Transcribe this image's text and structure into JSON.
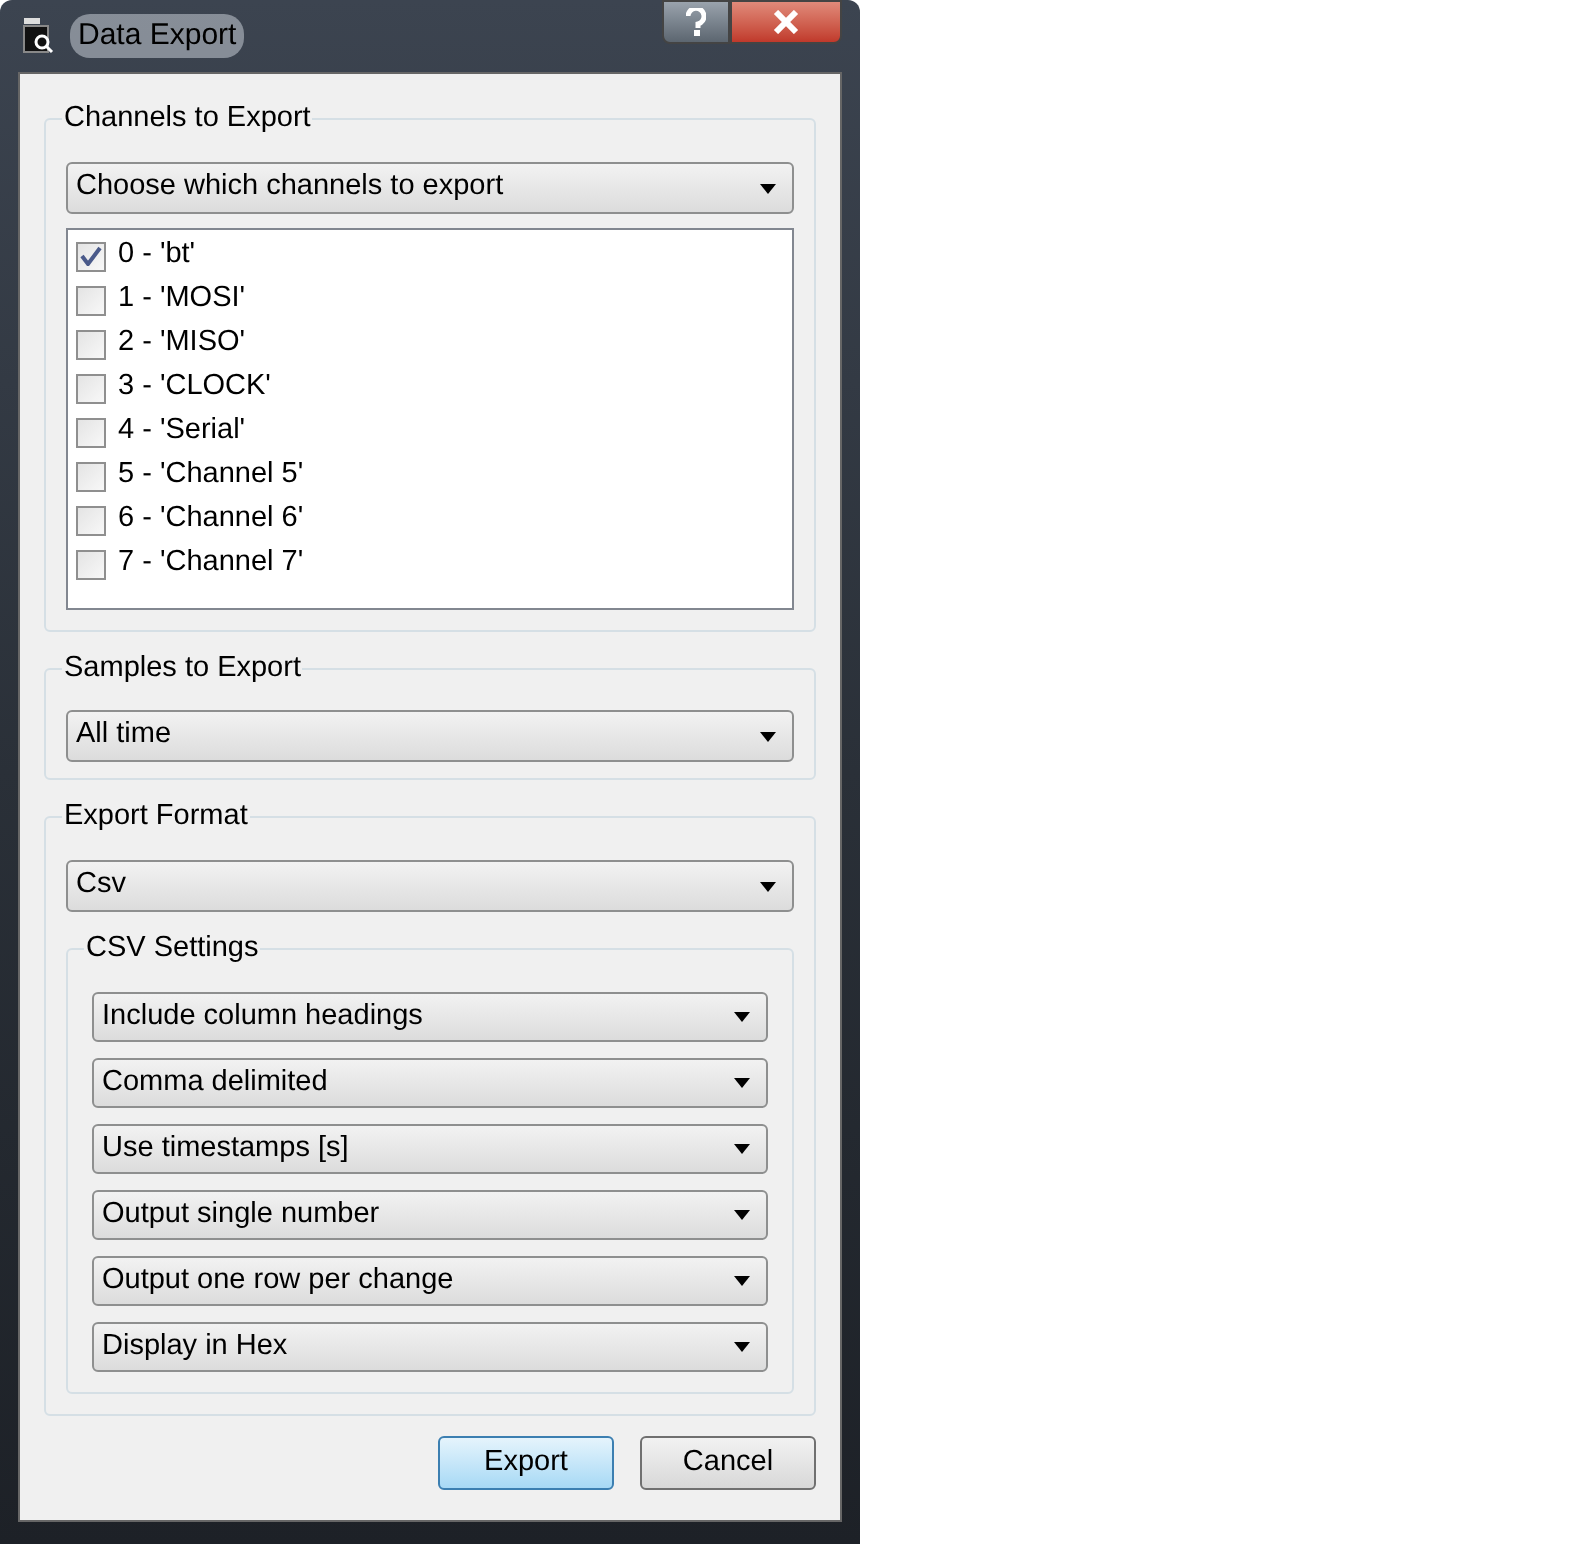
{
  "window": {
    "title": "Data Export"
  },
  "channels_group": {
    "title": "Channels to Export",
    "dropdown": "Choose which channels to export",
    "channels": [
      {
        "label": "0 - 'bt'",
        "checked": true
      },
      {
        "label": "1 - 'MOSI'",
        "checked": false
      },
      {
        "label": "2 - 'MISO'",
        "checked": false
      },
      {
        "label": "3 - 'CLOCK'",
        "checked": false
      },
      {
        "label": "4 - 'Serial'",
        "checked": false
      },
      {
        "label": "5 - 'Channel 5'",
        "checked": false
      },
      {
        "label": "6 - 'Channel 6'",
        "checked": false
      },
      {
        "label": "7 - 'Channel 7'",
        "checked": false
      }
    ]
  },
  "samples_group": {
    "title": "Samples to Export",
    "dropdown": "All time"
  },
  "format_group": {
    "title": "Export Format",
    "dropdown": "Csv",
    "csv_settings": {
      "title": "CSV Settings",
      "dropdowns": [
        "Include column headings",
        "Comma delimited",
        "Use timestamps [s]",
        "Output single number",
        "Output one row per change",
        "Display in Hex"
      ]
    }
  },
  "buttons": [
    {
      "label": "Export",
      "default": true
    },
    {
      "label": "Cancel",
      "default": false
    }
  ]
}
